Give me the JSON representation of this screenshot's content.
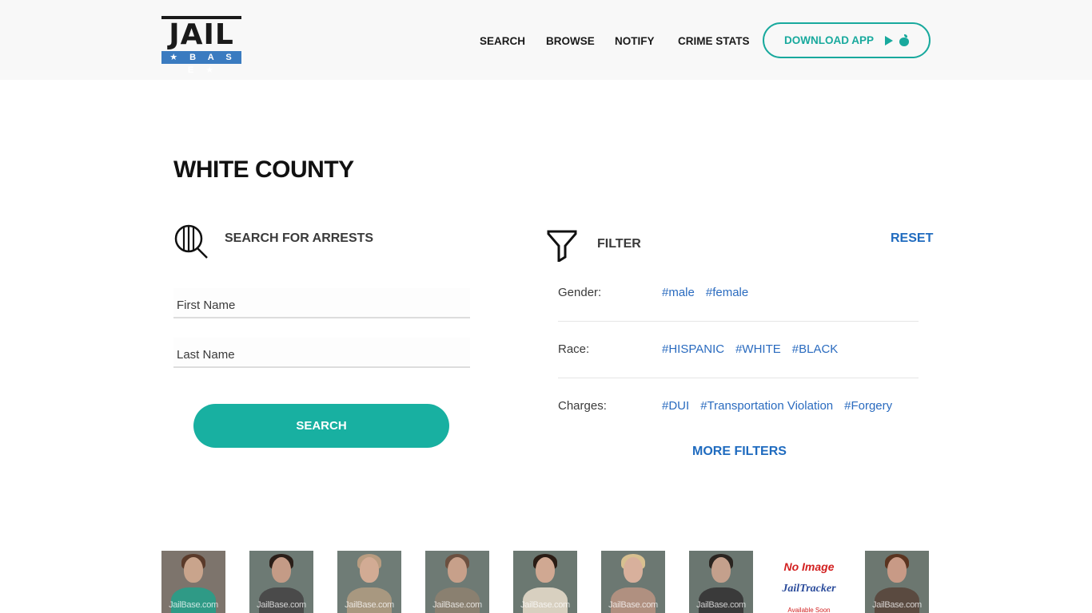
{
  "header": {
    "logo": {
      "top": "JAIL",
      "bottom": "★ B A S E ★"
    },
    "nav": [
      {
        "label": "SEARCH"
      },
      {
        "label": "BROWSE"
      },
      {
        "label": "NOTIFY"
      },
      {
        "label": "CRIME STATS"
      }
    ],
    "download_button": {
      "label": "DOWNLOAD APP",
      "icons": [
        "google-play-icon",
        "apple-icon"
      ]
    }
  },
  "page": {
    "title": "WHITE COUNTY"
  },
  "search_panel": {
    "label": "SEARCH FOR ARRESTS",
    "icon": "search-bars-icon",
    "first_name": {
      "value": "",
      "placeholder": "First Name"
    },
    "last_name": {
      "value": "",
      "placeholder": "Last Name"
    },
    "button_label": "SEARCH"
  },
  "filter_panel": {
    "label": "FILTER",
    "icon": "funnel-icon",
    "reset_label": "RESET",
    "rows": [
      {
        "label": "Gender:",
        "tags": [
          "#male",
          "#female"
        ]
      },
      {
        "label": "Race:",
        "tags": [
          "#HISPANIC",
          "#WHITE",
          "#BLACK"
        ]
      },
      {
        "label": "Charges:",
        "tags": [
          "#DUI",
          "#Transportation Violation",
          "#Forgery"
        ]
      }
    ],
    "more_filters_label": "MORE FILTERS"
  },
  "mugshots": {
    "watermark": "JailBase.com",
    "items": [
      {
        "type": "photo",
        "bg": "#7d746c",
        "skin": "#c9a48c",
        "hair": "#5a3a2a",
        "shirt": "#2f9a86"
      },
      {
        "type": "photo",
        "bg": "#6d7a74",
        "skin": "#c49b86",
        "hair": "#2a1e18",
        "shirt": "#4a4a4a"
      },
      {
        "type": "photo",
        "bg": "#6f7c76",
        "skin": "#d2ab94",
        "hair": "#b89c80",
        "shirt": "#a89880"
      },
      {
        "type": "photo",
        "bg": "#6e7a74",
        "skin": "#c7a08a",
        "hair": "#6b5040",
        "shirt": "#8a8070"
      },
      {
        "type": "photo",
        "bg": "#6b7871",
        "skin": "#d0a892",
        "hair": "#2a1c14",
        "shirt": "#d8d0c0"
      },
      {
        "type": "photo",
        "bg": "#6c7872",
        "skin": "#d8b09c",
        "hair": "#d8c090",
        "shirt": "#b09080"
      },
      {
        "type": "photo",
        "bg": "#6a7670",
        "skin": "#c4a08c",
        "hair": "#2a2420",
        "shirt": "#3a3a3a"
      },
      {
        "type": "no-image",
        "line1": "No Image",
        "line2": "JailTracker",
        "line3": "Available Soon"
      },
      {
        "type": "photo",
        "bg": "#6c7770",
        "skin": "#c89a86",
        "hair": "#5a3420",
        "shirt": "#5a4a40"
      }
    ]
  }
}
